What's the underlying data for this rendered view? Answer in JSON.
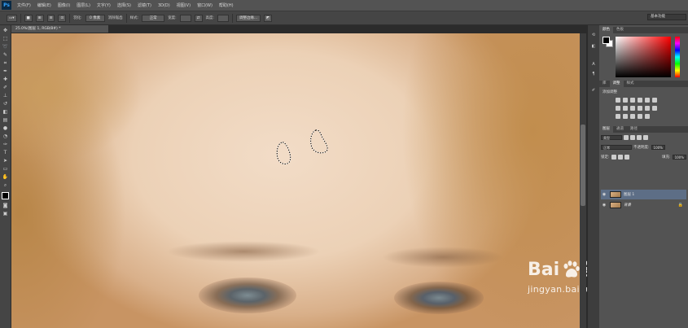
{
  "app": {
    "logo": "Ps",
    "workspace": "基本功能"
  },
  "menu": [
    "文件(F)",
    "编辑(E)",
    "图像(I)",
    "图层(L)",
    "文字(Y)",
    "选择(S)",
    "滤镜(T)",
    "3D(D)",
    "视图(V)",
    "窗口(W)",
    "帮助(H)"
  ],
  "options": {
    "feather_label": "羽化:",
    "feather_value": "0 像素",
    "antialias_label": "消除锯齿",
    "style_label": "样式:",
    "style_value": "正常",
    "width_label": "宽度:",
    "height_label": "高度:",
    "refine_edge": "调整边缘..."
  },
  "document": {
    "tab": "25.0%(图层 1, RGB/8#) *"
  },
  "tools": [
    "move-icon",
    "marquee-icon",
    "lasso-icon",
    "quick-select-icon",
    "crop-icon",
    "eyedropper-icon",
    "healing-brush-icon",
    "brush-icon",
    "clone-stamp-icon",
    "history-brush-icon",
    "eraser-icon",
    "gradient-icon",
    "blur-icon",
    "dodge-icon",
    "pen-icon",
    "type-icon",
    "path-select-icon",
    "shape-icon",
    "hand-icon",
    "zoom-icon"
  ],
  "panels": {
    "color_tabs": [
      "颜色",
      "色板"
    ],
    "adjust_tabs": [
      "库",
      "调整",
      "样式"
    ],
    "adjust_title": "添加调整",
    "layers_tabs": [
      "图层",
      "通道",
      "路径"
    ],
    "kind_label": "类型",
    "blend_mode": "正常",
    "opacity_label": "不透明度:",
    "opacity_value": "100%",
    "lock_label": "锁定:",
    "fill_label": "填充:",
    "fill_value": "100%",
    "layers": [
      {
        "name": "图层 1",
        "selected": true
      },
      {
        "name": "背景",
        "locked": true
      }
    ]
  },
  "watermark": {
    "brand": "Bai",
    "brand_suffix": "经验",
    "url": "jingyan.baidu.com"
  }
}
